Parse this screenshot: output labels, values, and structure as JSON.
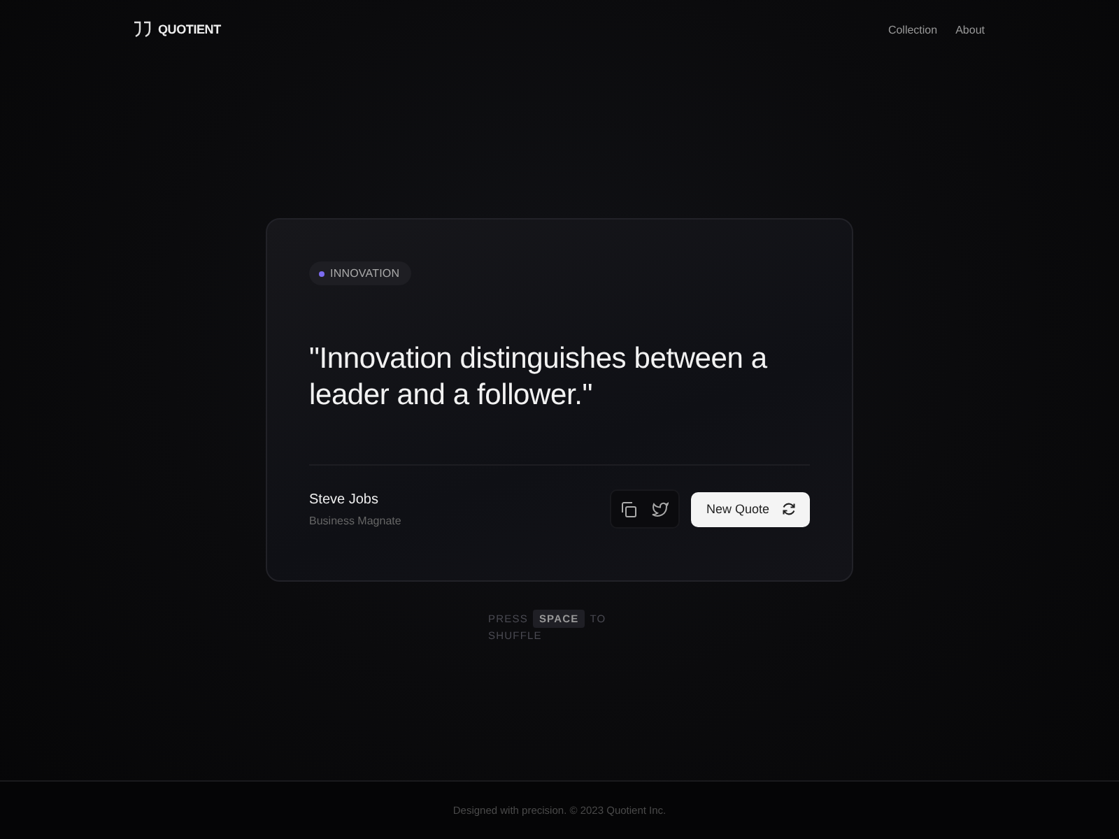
{
  "header": {
    "logo": "QUOTIENT",
    "nav": [
      {
        "label": "Collection"
      },
      {
        "label": "About"
      }
    ]
  },
  "quote": {
    "tag": {
      "label": "INNOVATION",
      "color": "#7c6cf0"
    },
    "text": "\"Innovation distinguishes between a leader and a follower.\"",
    "author": "Steve Jobs",
    "role": "Business Magnate",
    "button": "New Quote"
  },
  "hint": [
    {
      "kind": "text",
      "text": "PRESS"
    },
    {
      "kind": "key",
      "text": "SPACE"
    },
    {
      "kind": "text",
      "text": "TO"
    },
    {
      "kind": "text",
      "text": "SHUFFLE"
    }
  ],
  "footer": "Designed with precision. © 2023 Quotient Inc."
}
